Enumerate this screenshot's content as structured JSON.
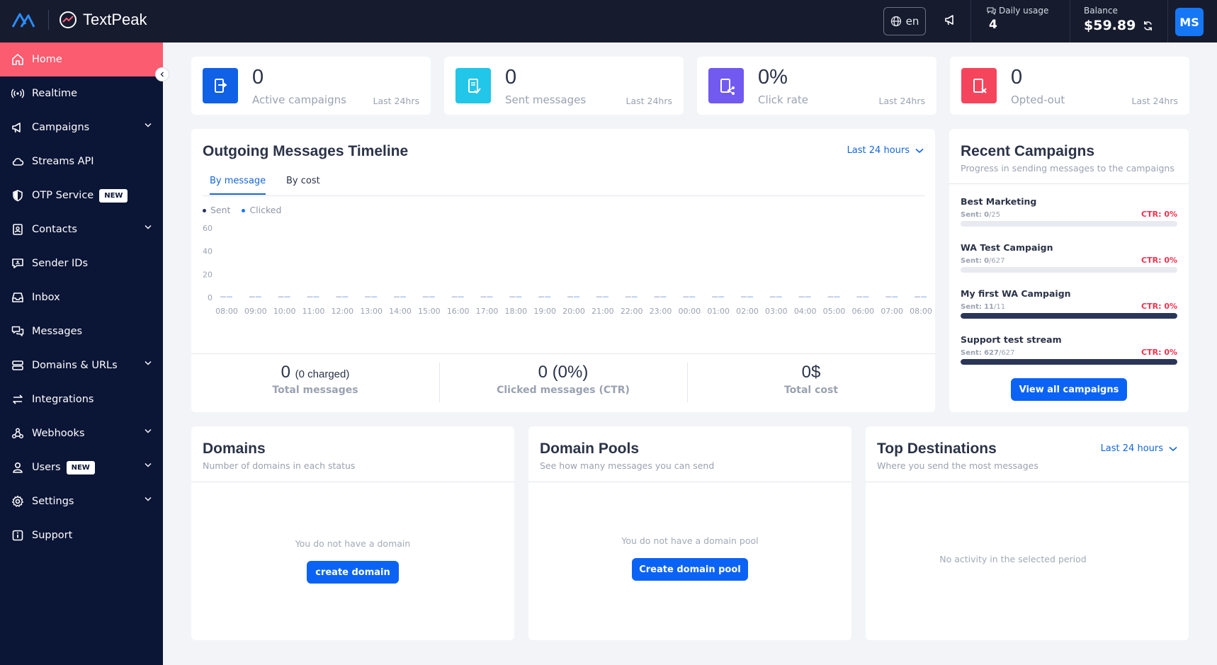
{
  "brand": {
    "name": "TextPeak"
  },
  "topbar": {
    "language": "en",
    "daily_usage_label": "Daily usage",
    "daily_usage_value": "4",
    "balance_label": "Balance",
    "balance_value": "$59.89",
    "avatar_initials": "MS"
  },
  "sidebar": {
    "items": [
      {
        "label": "Home",
        "icon": "home-icon",
        "active": true
      },
      {
        "label": "Realtime",
        "icon": "broadcast-icon"
      },
      {
        "label": "Campaigns",
        "icon": "megaphone-icon",
        "chevron": true
      },
      {
        "label": "Streams API",
        "icon": "cloud-icon"
      },
      {
        "label": "OTP Service",
        "icon": "shield-icon",
        "badge": "NEW"
      },
      {
        "label": "Contacts",
        "icon": "contact-book-icon",
        "chevron": true
      },
      {
        "label": "Sender IDs",
        "icon": "id-chat-icon"
      },
      {
        "label": "Inbox",
        "icon": "inbox-icon"
      },
      {
        "label": "Messages",
        "icon": "messages-icon"
      },
      {
        "label": "Domains & URLs",
        "icon": "server-icon",
        "chevron": true
      },
      {
        "label": "Integrations",
        "icon": "arrows-exchange-icon"
      },
      {
        "label": "Webhooks",
        "icon": "webhook-icon",
        "chevron": true
      },
      {
        "label": "Users",
        "icon": "user-icon",
        "badge": "NEW",
        "chevron": true
      },
      {
        "label": "Settings",
        "icon": "gear-icon",
        "chevron": true
      },
      {
        "label": "Support",
        "icon": "info-icon"
      }
    ]
  },
  "stats": [
    {
      "value": "0",
      "label": "Active campaigns",
      "period": "Last 24hrs",
      "color": "#1061e5"
    },
    {
      "value": "0",
      "label": "Sent messages",
      "period": "Last 24hrs",
      "color": "#21c6e8"
    },
    {
      "value": "0%",
      "label": "Click rate",
      "period": "Last 24hrs",
      "color": "#7259f0"
    },
    {
      "value": "0",
      "label": "Opted-out",
      "period": "Last 24hrs",
      "color": "#f5455c"
    }
  ],
  "timeline": {
    "title": "Outgoing Messages Timeline",
    "period": "Last 24 hours",
    "tabs": [
      "By message",
      "By cost"
    ],
    "legend": [
      "Sent",
      "Clicked"
    ],
    "total_messages_value": "0",
    "total_messages_extra": "(0 charged)",
    "total_messages_label": "Total messages",
    "clicked_value": "0 (0%)",
    "clicked_label": "Clicked messages (CTR)",
    "cost_value": "0$",
    "cost_label": "Total cost"
  },
  "chart_data": {
    "type": "bar",
    "categories": [
      "08:00",
      "09:00",
      "10:00",
      "11:00",
      "12:00",
      "13:00",
      "14:00",
      "15:00",
      "16:00",
      "17:00",
      "18:00",
      "19:00",
      "20:00",
      "21:00",
      "22:00",
      "23:00",
      "00:00",
      "01:00",
      "02:00",
      "03:00",
      "04:00",
      "05:00",
      "06:00",
      "07:00",
      "08:00"
    ],
    "series": [
      {
        "name": "Sent",
        "values": [
          0,
          0,
          0,
          0,
          0,
          0,
          0,
          0,
          0,
          0,
          0,
          0,
          0,
          0,
          0,
          0,
          0,
          0,
          0,
          0,
          0,
          0,
          0,
          0,
          0
        ]
      },
      {
        "name": "Clicked",
        "values": [
          0,
          0,
          0,
          0,
          0,
          0,
          0,
          0,
          0,
          0,
          0,
          0,
          0,
          0,
          0,
          0,
          0,
          0,
          0,
          0,
          0,
          0,
          0,
          0,
          0
        ]
      }
    ],
    "yticks": [
      0,
      20,
      40,
      60
    ],
    "ylim": [
      0,
      60
    ],
    "grid": false,
    "legend": "top-left",
    "colors": {
      "sent": "#2b3557",
      "clicked": "#1577f5"
    }
  },
  "recent": {
    "title": "Recent Campaigns",
    "subtitle": "Progress in sending messages to the campaigns",
    "sent_prefix": "Sent:",
    "campaigns": [
      {
        "name": "Best Marketing",
        "sent": "0",
        "total": "/25",
        "ctr": "CTR: 0%",
        "progress": 0
      },
      {
        "name": "WA Test Campaign",
        "sent": "0",
        "total": "/627",
        "ctr": "CTR: 0%",
        "progress": 0
      },
      {
        "name": "My first WA Campaign",
        "sent": "11",
        "total": "/11",
        "ctr": "CTR: 0%",
        "progress": 1
      },
      {
        "name": "Support test stream",
        "sent": "627",
        "total": "/627",
        "ctr": "CTR: 0%",
        "progress": 1
      }
    ],
    "button": "View all campaigns"
  },
  "domains": {
    "title": "Domains",
    "subtitle": "Number of domains in each status",
    "empty": "You do not have a domain",
    "button": "create domain"
  },
  "pools": {
    "title": "Domain Pools",
    "subtitle": "See how many messages you can send",
    "empty": "You do not have a domain pool",
    "button": "Create domain pool"
  },
  "destinations": {
    "title": "Top Destinations",
    "subtitle": "Where you send the most messages",
    "period": "Last 24 hours",
    "empty": "No activity in the selected period"
  }
}
